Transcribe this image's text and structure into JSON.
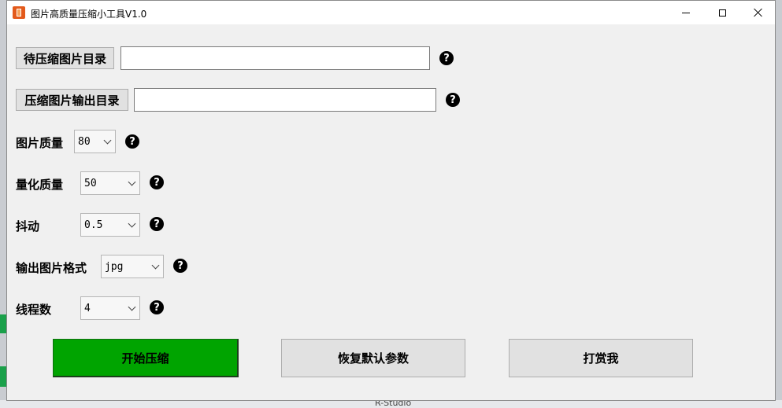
{
  "window": {
    "title": "图片高质量压缩小工具V1.0"
  },
  "input_dir": {
    "button_label": "待压缩图片目录",
    "value": ""
  },
  "output_dir": {
    "button_label": "压缩图片输出目录",
    "value": ""
  },
  "settings": {
    "quality": {
      "label": "图片质量",
      "value": "80"
    },
    "quantize": {
      "label": "量化质量",
      "value": "50"
    },
    "dither": {
      "label": "抖动",
      "value": "0.5"
    },
    "format": {
      "label": "输出图片格式",
      "value": "jpg"
    },
    "threads": {
      "label": "线程数",
      "value": "4"
    }
  },
  "help_glyph": "?",
  "actions": {
    "start": "开始压缩",
    "reset": "恢复默认参数",
    "donate": "打赏我"
  },
  "background": {
    "partial_text": "R-Studio"
  },
  "colors": {
    "start_button": "#00a400",
    "window_bg": "#f0f0f0"
  }
}
